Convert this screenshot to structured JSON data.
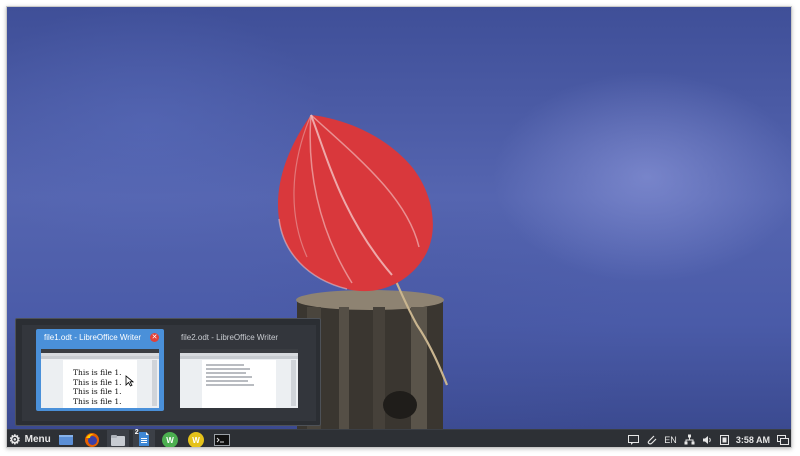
{
  "taskbar": {
    "menu_label": "Menu",
    "launchers": [
      {
        "icon": "show-desktop-icon"
      },
      {
        "icon": "firefox-icon"
      },
      {
        "icon": "file-manager-icon"
      },
      {
        "icon": "libreoffice-writer-icon",
        "badge": "2"
      },
      {
        "icon": "wps-writer-icon"
      },
      {
        "icon": "wps-presentation-icon"
      },
      {
        "icon": "terminal-icon"
      }
    ],
    "tray": {
      "language": "EN",
      "clock": "3:58 AM"
    }
  },
  "switcher": {
    "windows": [
      {
        "title": "file1.odt - LibreOffice Writer",
        "active": true,
        "content_lines": [
          "This is file 1.",
          "This is file 1.",
          "This is file 1.",
          "This is file 1."
        ]
      },
      {
        "title": "file2.odt - LibreOffice Writer",
        "active": false
      }
    ]
  },
  "colors": {
    "taskbar_bg": "#2d3035",
    "accent": "#4a90d9",
    "close": "#e0413a"
  }
}
